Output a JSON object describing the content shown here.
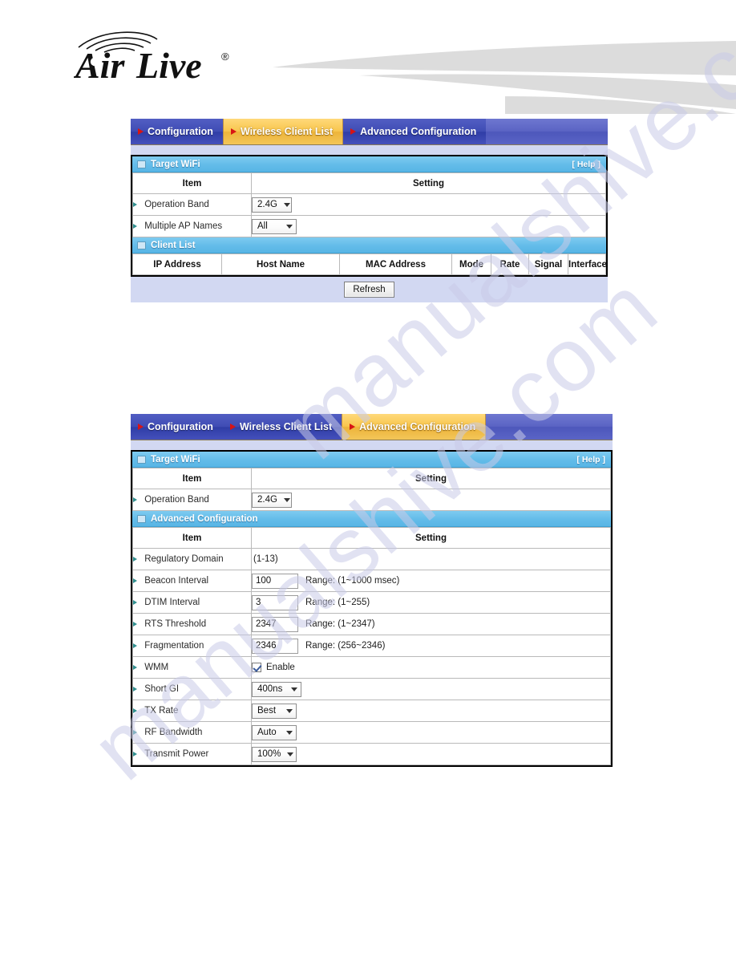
{
  "brand": {
    "logo_text": "AirLive",
    "registered_mark": "®"
  },
  "watermark": {
    "text": "manualshive.com"
  },
  "panel1": {
    "tabs": [
      {
        "label": "Configuration",
        "active": false
      },
      {
        "label": "Wireless Client List",
        "active": true
      },
      {
        "label": "Advanced Configuration",
        "active": false
      }
    ],
    "target_wifi": {
      "section_title": "Target WiFi",
      "help_label": "[ Help ]",
      "columns": [
        "Item",
        "Setting"
      ],
      "rows": [
        {
          "item": "Operation Band",
          "control": "select",
          "value": "2.4G"
        },
        {
          "item": "Multiple AP Names",
          "control": "select",
          "value": "All"
        }
      ]
    },
    "client_list": {
      "section_title": "Client List",
      "columns": [
        "IP Address",
        "Host Name",
        "MAC Address",
        "Mode",
        "Rate",
        "Signal",
        "Interface"
      ],
      "rows": []
    },
    "refresh_label": "Refresh"
  },
  "panel2": {
    "tabs": [
      {
        "label": "Configuration",
        "active": false
      },
      {
        "label": "Wireless Client List",
        "active": false
      },
      {
        "label": "Advanced Configuration",
        "active": true
      }
    ],
    "target_wifi": {
      "section_title": "Target WiFi",
      "help_label": "[ Help ]",
      "columns": [
        "Item",
        "Setting"
      ],
      "rows": [
        {
          "item": "Operation Band",
          "control": "select",
          "value": "2.4G"
        }
      ]
    },
    "advanced": {
      "section_title": "Advanced Configuration",
      "columns": [
        "Item",
        "Setting"
      ],
      "rows": [
        {
          "item": "Regulatory Domain",
          "control": "text-plain",
          "value": "(1-13)",
          "hint": ""
        },
        {
          "item": "Beacon Interval",
          "control": "input",
          "value": "100",
          "hint": "Range: (1~1000 msec)"
        },
        {
          "item": "DTIM Interval",
          "control": "input",
          "value": "3",
          "hint": "Range: (1~255)"
        },
        {
          "item": "RTS Threshold",
          "control": "input",
          "value": "2347",
          "hint": "Range: (1~2347)"
        },
        {
          "item": "Fragmentation",
          "control": "input",
          "value": "2346",
          "hint": "Range: (256~2346)"
        },
        {
          "item": "WMM",
          "control": "checkbox",
          "value": "Enable",
          "checked": true,
          "hint": ""
        },
        {
          "item": "Short GI",
          "control": "select",
          "value": "400ns",
          "hint": ""
        },
        {
          "item": "TX Rate",
          "control": "select",
          "value": "Best",
          "hint": ""
        },
        {
          "item": "RF Bandwidth",
          "control": "select",
          "value": "Auto",
          "hint": ""
        },
        {
          "item": "Transmit Power",
          "control": "select",
          "value": "100%",
          "hint": ""
        }
      ]
    }
  },
  "colors": {
    "tab_active": "#f3c659",
    "tab_inactive": "#3f4cb4",
    "tabbar": "#5b64c4",
    "section_bar": "#63bce9",
    "panel_foot": "#d2d8f2",
    "bullet": "#2f8f8f",
    "arrow_red": "#d81414",
    "watermark": "#c9cbe8"
  }
}
